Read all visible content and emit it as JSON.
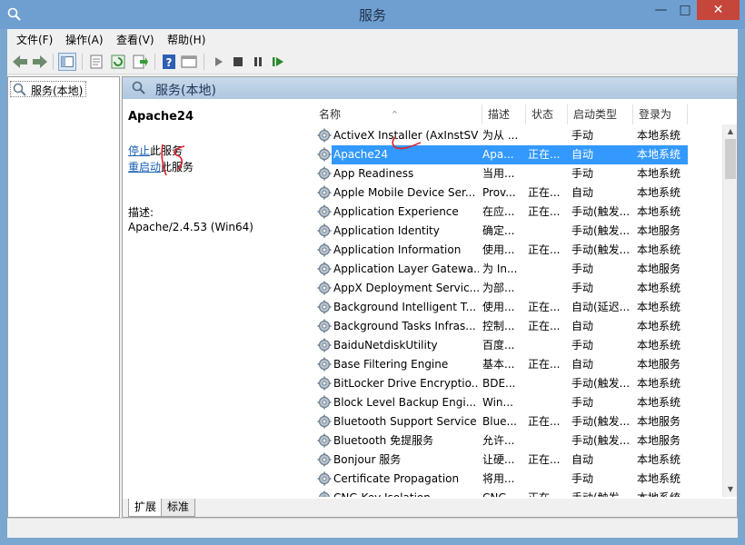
{
  "window": {
    "title": "服务",
    "minimize": "—",
    "maximize": "□",
    "close": "✕"
  },
  "menu": [
    "文件(F)",
    "操作(A)",
    "查看(V)",
    "帮助(H)"
  ],
  "tree": {
    "item": "服务(本地)"
  },
  "main": {
    "title": "服务(本地)"
  },
  "detail": {
    "service_name": "Apache24",
    "stop_link": "停止",
    "stop_suffix": "此服务",
    "restart_link": "重启动",
    "restart_suffix": "此服务",
    "desc_label": "描述:",
    "desc_text": "Apache/2.4.53 (Win64)"
  },
  "columns": [
    "名称",
    "描述",
    "状态",
    "启动类型",
    "登录为"
  ],
  "rows": [
    [
      "ActiveX Installer (AxInstSV)",
      "为从 ...",
      "",
      "手动",
      "本地系统"
    ],
    [
      "Apache24",
      "Apa...",
      "正在...",
      "自动",
      "本地系统"
    ],
    [
      "App Readiness",
      "当用...",
      "",
      "手动",
      "本地系统"
    ],
    [
      "Apple Mobile Device Ser...",
      "Prov...",
      "正在...",
      "自动",
      "本地系统"
    ],
    [
      "Application Experience",
      "在应...",
      "正在...",
      "手动(触发...",
      "本地系统"
    ],
    [
      "Application Identity",
      "确定...",
      "",
      "手动(触发...",
      "本地服务"
    ],
    [
      "Application Information",
      "使用...",
      "正在...",
      "手动(触发...",
      "本地系统"
    ],
    [
      "Application Layer Gatewa...",
      "为 In...",
      "",
      "手动",
      "本地服务"
    ],
    [
      "AppX Deployment Servic...",
      "为部...",
      "",
      "手动",
      "本地系统"
    ],
    [
      "Background Intelligent T...",
      "使用...",
      "正在...",
      "自动(延迟...",
      "本地系统"
    ],
    [
      "Background Tasks Infras...",
      "控制...",
      "正在...",
      "自动",
      "本地系统"
    ],
    [
      "BaiduNetdiskUtility",
      "百度...",
      "",
      "手动",
      "本地系统"
    ],
    [
      "Base Filtering Engine",
      "基本...",
      "正在...",
      "自动",
      "本地服务"
    ],
    [
      "BitLocker Drive Encryptio...",
      "BDE...",
      "",
      "手动(触发...",
      "本地系统"
    ],
    [
      "Block Level Backup Engi...",
      "Win...",
      "",
      "手动",
      "本地系统"
    ],
    [
      "Bluetooth Support Service",
      "Blue...",
      "正在...",
      "手动(触发...",
      "本地服务"
    ],
    [
      "Bluetooth 免提服务",
      "允许...",
      "",
      "手动(触发...",
      "本地服务"
    ],
    [
      "Bonjour 服务",
      "让硬...",
      "正在...",
      "自动",
      "本地系统"
    ],
    [
      "Certificate Propagation",
      "将用...",
      "",
      "手动",
      "本地系统"
    ],
    [
      "CNG Key Isolation",
      "CNG...",
      "正在...",
      "手动(触发...",
      "本地系统"
    ]
  ],
  "selected_row": 1,
  "tabs": [
    "扩展",
    "标准"
  ],
  "colors": {
    "titlebar": "#6f9fd0",
    "selection": "#3399ff",
    "close": "#c7463c",
    "link": "#1a5fb4",
    "annotation": "#e0202a"
  }
}
